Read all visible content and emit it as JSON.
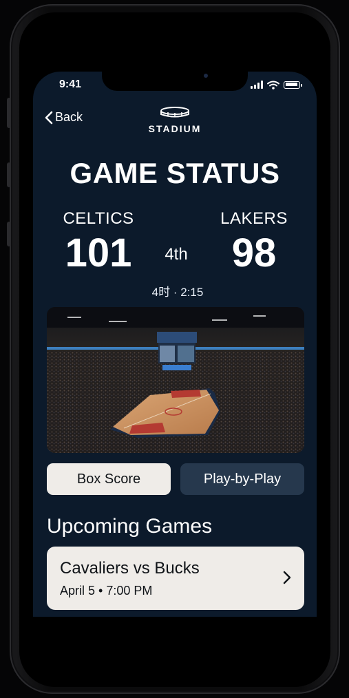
{
  "status_bar": {
    "time": "9:41",
    "icons": [
      "cellular-signal-icon",
      "wifi-icon",
      "battery-icon"
    ]
  },
  "nav": {
    "back_label": "Back",
    "brand": "STADIUM",
    "brand_icon": "stadium-logo-icon"
  },
  "title": "GAME STATUS",
  "scoreboard": {
    "home": {
      "name": "CELTICS",
      "score": "101"
    },
    "away": {
      "name": "LAKERS",
      "score": "98"
    },
    "period": "4th",
    "clock": "4时 · 2:15"
  },
  "actions": {
    "box_score": "Box Score",
    "play_by_play": "Play-by-Play"
  },
  "upcoming": {
    "heading": "Upcoming Games",
    "games": [
      {
        "matchup": "Cavaliers vs Bucks",
        "when": "April 5 • 7:00 PM"
      }
    ]
  },
  "colors": {
    "screen_bg": "#0c1a2b",
    "button_light": "#efece8",
    "button_dark": "#26384d",
    "text_primary": "#ffffff",
    "text_dark": "#101418"
  }
}
